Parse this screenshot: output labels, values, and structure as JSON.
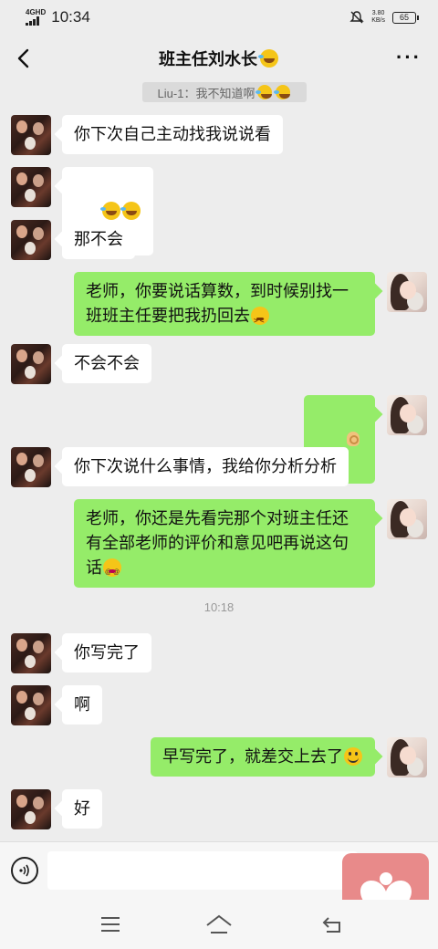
{
  "status_bar": {
    "network": "4G",
    "network_sup": "HD",
    "time": "10:34",
    "speed_value": "3.80",
    "speed_unit": "KB/s",
    "battery": "65"
  },
  "nav": {
    "title": "班主任刘水长",
    "title_icon": "laughing-tears-icon"
  },
  "chat": {
    "recall_notice": "Liu-1：我不知道啊",
    "time_label": "10:18",
    "messages": [
      {
        "from": "teacher",
        "text": "你下次自己主动找我说说看"
      },
      {
        "from": "teacher",
        "text": "",
        "emoji": [
          "laughing-tears-icon",
          "laughing-tears-icon"
        ]
      },
      {
        "from": "teacher",
        "text": "那不会"
      },
      {
        "from": "me",
        "text": "老师，你要说话算数，到时候别找一\n班班主任要把我扔回去",
        "emoji": [
          "angry-face-icon"
        ]
      },
      {
        "from": "teacher",
        "text": "不会不会"
      },
      {
        "from": "me",
        "text": "",
        "emoji": [
          "ok-hand-icon"
        ]
      },
      {
        "from": "teacher",
        "text": "你下次说什么事情，我给你分析分析"
      },
      {
        "from": "me",
        "text": "老师，你还是先看完那个对班主任还\n有全部老师的评价和意见吧再说这句\n话",
        "emoji": [
          "dizzy-face-icon"
        ]
      },
      {
        "from": "teacher",
        "text": "你写完了"
      },
      {
        "from": "teacher",
        "text": "啊"
      },
      {
        "from": "me",
        "text": "早写完了，就差交上去了",
        "emoji": [
          "grin-face-icon"
        ]
      },
      {
        "from": "teacher",
        "text": "好"
      }
    ]
  },
  "input": {
    "placeholder": ""
  },
  "colors": {
    "background": "#ededed",
    "my_bubble": "#95ec69",
    "their_bubble": "#ffffff",
    "float_button": "#e88a8a"
  }
}
